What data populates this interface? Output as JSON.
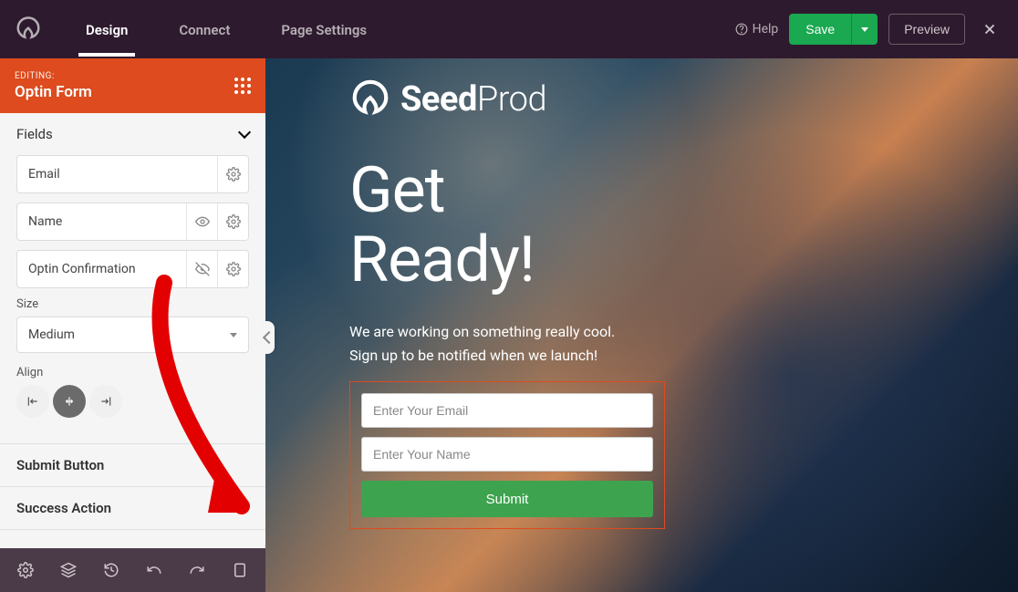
{
  "topbar": {
    "tabs": [
      "Design",
      "Connect",
      "Page Settings"
    ],
    "help": "Help",
    "save": "Save",
    "preview": "Preview"
  },
  "sidebar": {
    "editing_label": "EDITING:",
    "editing_title": "Optin Form",
    "fields_section": "Fields",
    "fields": [
      "Email",
      "Name",
      "Optin Confirmation"
    ],
    "size_label": "Size",
    "size_value": "Medium",
    "align_label": "Align",
    "submit_section": "Submit Button",
    "success_section": "Success Action"
  },
  "canvas": {
    "logo_text_bold": "Seed",
    "logo_text_light": "Prod",
    "headline_l1": "Get",
    "headline_l2": "Ready!",
    "sub_l1": "We are working on something really cool.",
    "sub_l2": "Sign up to be notified when we launch!",
    "email_ph": "Enter Your Email",
    "name_ph": "Enter Your Name",
    "submit": "Submit"
  },
  "colors": {
    "accent": "#dd4b1e",
    "success": "#1aa850"
  }
}
